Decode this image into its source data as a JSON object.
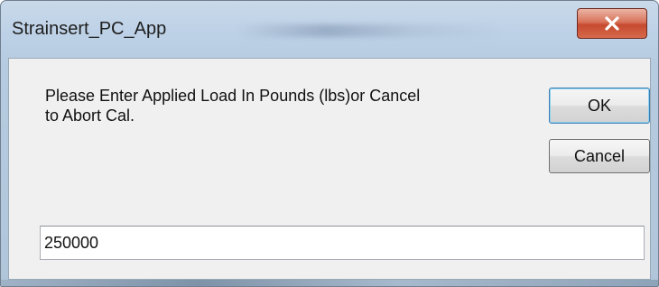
{
  "window": {
    "title": "Strainsert_PC_App",
    "close_icon": "close-x-icon"
  },
  "dialog": {
    "message": "Please Enter Applied Load In Pounds (lbs)or Cancel\nto Abort Cal.",
    "ok_label": "OK",
    "cancel_label": "Cancel",
    "input_value": "250000"
  },
  "colors": {
    "close_button": "#c64a2f",
    "default_button_border": "#3c7fb1",
    "client_background": "#f0f0f0"
  }
}
